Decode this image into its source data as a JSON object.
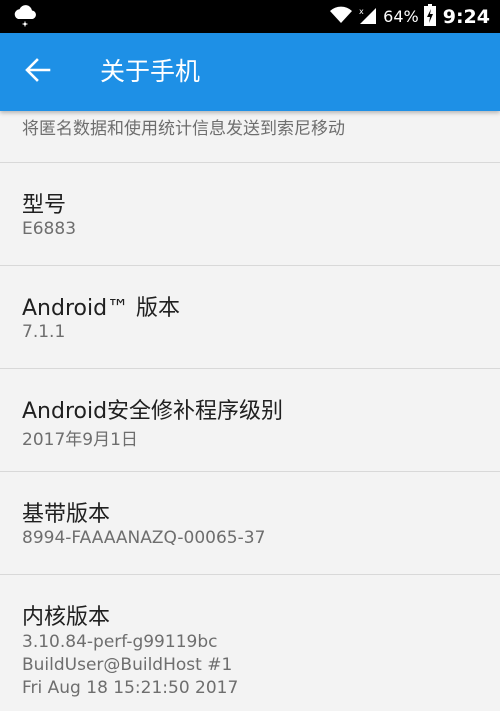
{
  "status_bar": {
    "battery_percent": "64%",
    "time": "9:24",
    "icons": [
      "weather-cloud-icon",
      "wifi-icon",
      "signal-icon",
      "battery-charging-icon"
    ]
  },
  "app_bar": {
    "title": "关于手机",
    "back_icon": "arrow-left-icon",
    "background_color": "#1e90e6"
  },
  "partial_item": {
    "summary": "将匿名数据和使用统计信息发送到索尼移动"
  },
  "items": {
    "model": {
      "title": "型号",
      "value": "E6883"
    },
    "android_version": {
      "title": "Android™ 版本",
      "value": "7.1.1"
    },
    "security_patch": {
      "title": "Android安全修补程序级别",
      "value": "2017年9月1日"
    },
    "baseband": {
      "title": "基带版本",
      "value": "8994-FAAAANAZQ-00065-37"
    },
    "kernel": {
      "title": "内核版本",
      "lines": [
        "3.10.84-perf-g99119bc",
        "BuildUser@BuildHost #1",
        "Fri Aug 18 15:21:50 2017"
      ]
    }
  }
}
